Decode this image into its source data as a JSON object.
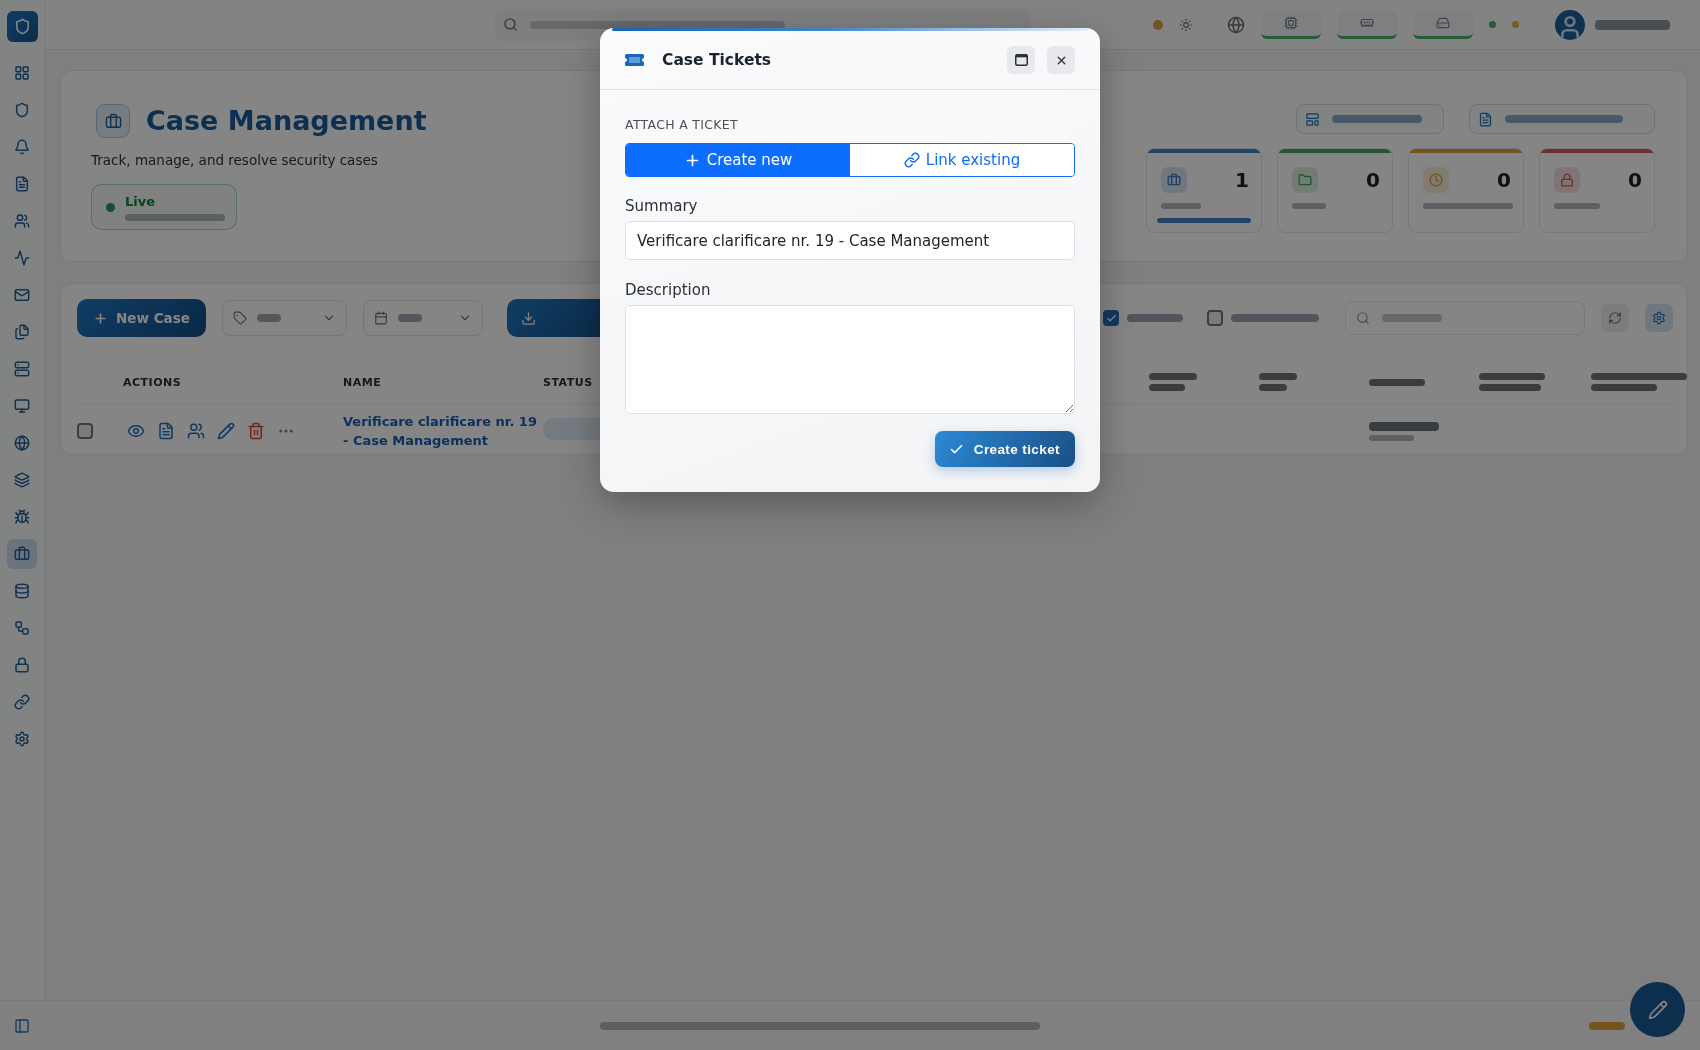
{
  "sidebar": {
    "items": [
      {
        "selected": false
      },
      {
        "selected": false
      },
      {
        "selected": false
      },
      {
        "selected": false
      },
      {
        "selected": false
      },
      {
        "selected": false
      },
      {
        "selected": false
      },
      {
        "selected": false
      },
      {
        "selected": false
      },
      {
        "selected": false
      },
      {
        "selected": false
      },
      {
        "selected": false
      },
      {
        "selected": false
      },
      {
        "selected": true
      },
      {
        "selected": false
      },
      {
        "selected": false
      },
      {
        "selected": false
      },
      {
        "selected": false
      },
      {
        "selected": false
      }
    ]
  },
  "header": {
    "title": "Case Management",
    "subtitle": "Track, manage, and resolve security cases",
    "status": "Live"
  },
  "stats": [
    {
      "value": "1",
      "level": 1
    },
    {
      "value": "0"
    },
    {
      "value": "0"
    },
    {
      "value": "0"
    }
  ],
  "toolbar": {
    "new_case": "New Case",
    "filters": [
      {
        "checked": true
      },
      {
        "checked": false
      }
    ]
  },
  "table": {
    "columns": [
      "ACTIONS",
      "NAME",
      "STATUS"
    ],
    "rows": [
      {
        "checked": false,
        "name": "Verificare clarificare nr. 19 - Case Management"
      }
    ]
  },
  "dialog": {
    "title": "Case Tickets",
    "section": "ATTACH A TICKET",
    "modes": [
      {
        "kind": "create",
        "label": "Create new",
        "selected": true
      },
      {
        "kind": "link",
        "label": "Link existing",
        "selected": false
      }
    ],
    "fields": [
      {
        "kind": "input",
        "label": "Summary",
        "value": "Verificare clarificare nr. 19 - Case Management"
      },
      {
        "kind": "textarea",
        "label": "Description"
      }
    ],
    "submit": "Create ticket"
  }
}
